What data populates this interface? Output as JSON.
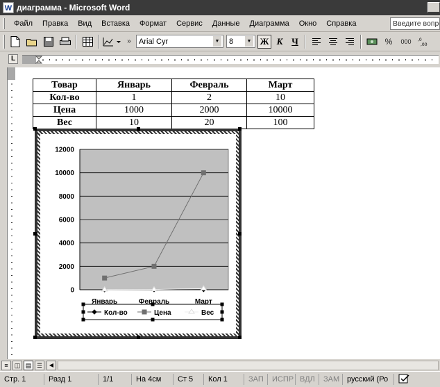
{
  "window": {
    "title": "диаграмма - Microsoft Word",
    "app_icon_letter": "W"
  },
  "menu": {
    "items": [
      "Файл",
      "Правка",
      "Вид",
      "Вставка",
      "Формат",
      "Сервис",
      "Данные",
      "Диаграмма",
      "Окно",
      "Справка"
    ],
    "help_placeholder": "Введите вопрос"
  },
  "toolbar": {
    "font_name": "Arial Cyr",
    "font_size": "8",
    "bold_label": "Ж",
    "italic_label": "К",
    "underline_label": "Ч",
    "percent_label": "%",
    "thousands_label": "000"
  },
  "ruler": {
    "tab_selector": "L"
  },
  "table": {
    "header": [
      "Товар",
      "Январь",
      "Февраль",
      "Март"
    ],
    "rows": [
      [
        "Кол-во",
        "1",
        "2",
        "10"
      ],
      [
        "Цена",
        "1000",
        "2000",
        "10000"
      ],
      [
        "Вес",
        "10",
        "20",
        "100"
      ]
    ]
  },
  "chart_data": {
    "type": "line",
    "categories": [
      "Январь",
      "Февраль",
      "Март"
    ],
    "series": [
      {
        "name": "Кол-во",
        "values": [
          1,
          2,
          10
        ],
        "color": "#000000",
        "marker": "diamond"
      },
      {
        "name": "Цена",
        "values": [
          1000,
          2000,
          10000
        ],
        "color": "#707070",
        "marker": "square"
      },
      {
        "name": "Вес",
        "values": [
          10,
          20,
          100
        ],
        "color": "#ffffff",
        "marker": "triangle"
      }
    ],
    "ylim": [
      0,
      12000
    ],
    "yticks": [
      "0",
      "2000",
      "4000",
      "6000",
      "8000",
      "10000",
      "12000"
    ],
    "plot_background": "#c0c0c0",
    "grid": true,
    "legend_position": "bottom"
  },
  "status": {
    "page": "Стр. 1",
    "section": "Разд 1",
    "pages": "1/1",
    "at": "На 4см",
    "line": "Ст 5",
    "col": "Кол 1",
    "rec": "ЗАП",
    "trk": "ИСПР",
    "ext": "ВДЛ",
    "ovr": "ЗАМ",
    "language": "русский (Ро"
  }
}
